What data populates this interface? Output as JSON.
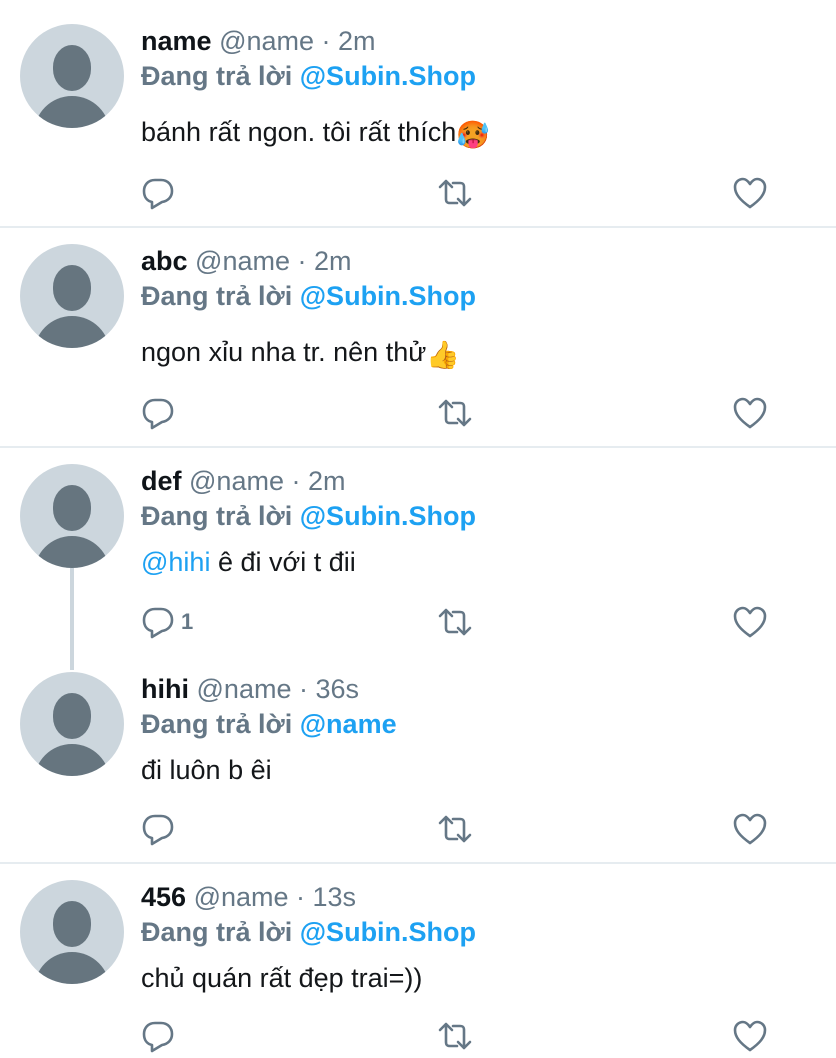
{
  "tweets": [
    {
      "name": "name",
      "meta": "@name · 2m",
      "replying_label": "Đang trả lời",
      "replying_to": "@Subin.Shop",
      "text": "bánh rất ngon. tôi rất thích",
      "emoji": "🥵"
    },
    {
      "name": "abc",
      "meta": "@name · 2m",
      "replying_label": "Đang trả lời",
      "replying_to": "@Subin.Shop",
      "text": "ngon xỉu nha tr. nên thử",
      "emoji": "👍"
    },
    {
      "name": "def",
      "meta": "@name · 2m",
      "replying_label": "Đang trả lời",
      "replying_to": "@Subin.Shop",
      "mention": "@hihi",
      "text": " ê đi với t đii",
      "reply_count": "1"
    },
    {
      "name": "hihi",
      "meta": "@name · 36s",
      "replying_label": "Đang trả lời",
      "replying_to": "@name",
      "text": "đi luôn b êi"
    },
    {
      "name": "456",
      "meta": "@name · 13s",
      "replying_label": "Đang trả lời",
      "replying_to": "@Subin.Shop",
      "text": "chủ quán rất đẹp trai=))"
    }
  ],
  "icons": {
    "reply": "reply-icon",
    "retweet": "retweet-icon",
    "like": "heart-icon"
  },
  "colors": {
    "link": "#1da1f2",
    "secondary": "#657786",
    "avatar_bg": "#ccd6dd",
    "avatar_fg": "#66757f",
    "divider": "#e6ecf0"
  }
}
